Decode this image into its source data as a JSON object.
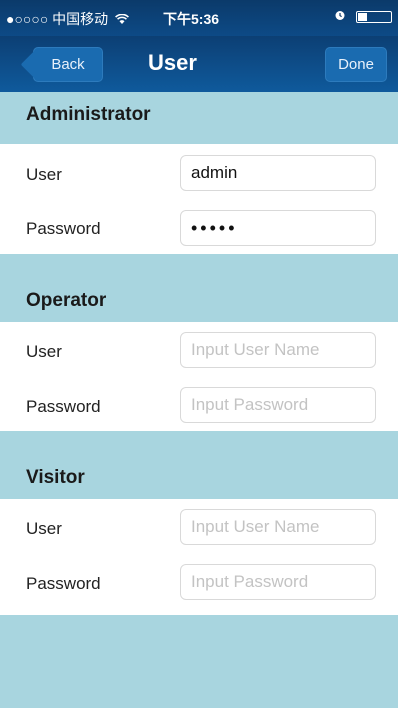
{
  "status_bar": {
    "carrier": "●○○○○ 中国移动",
    "wifi_icon": "wifi-icon",
    "time": "下午5:36",
    "alarm_icon": "alarm-icon",
    "battery_level": 0.3
  },
  "nav": {
    "back_label": "Back",
    "title": "User",
    "done_label": "Done"
  },
  "sections": {
    "administrator": {
      "title": "Administrator",
      "user_label": "User",
      "user_value": "admin",
      "password_label": "Password",
      "password_value": "•••••"
    },
    "operator": {
      "title": "Operator",
      "user_label": "User",
      "user_placeholder": "Input User Name",
      "password_label": "Password",
      "password_placeholder": "Input Password"
    },
    "visitor": {
      "title": "Visitor",
      "user_label": "User",
      "user_placeholder": "Input User Name",
      "password_label": "Password",
      "password_placeholder": "Input Password"
    }
  },
  "colors": {
    "nav_bar": "#0f5a9c",
    "section_header": "#a8d5df"
  }
}
